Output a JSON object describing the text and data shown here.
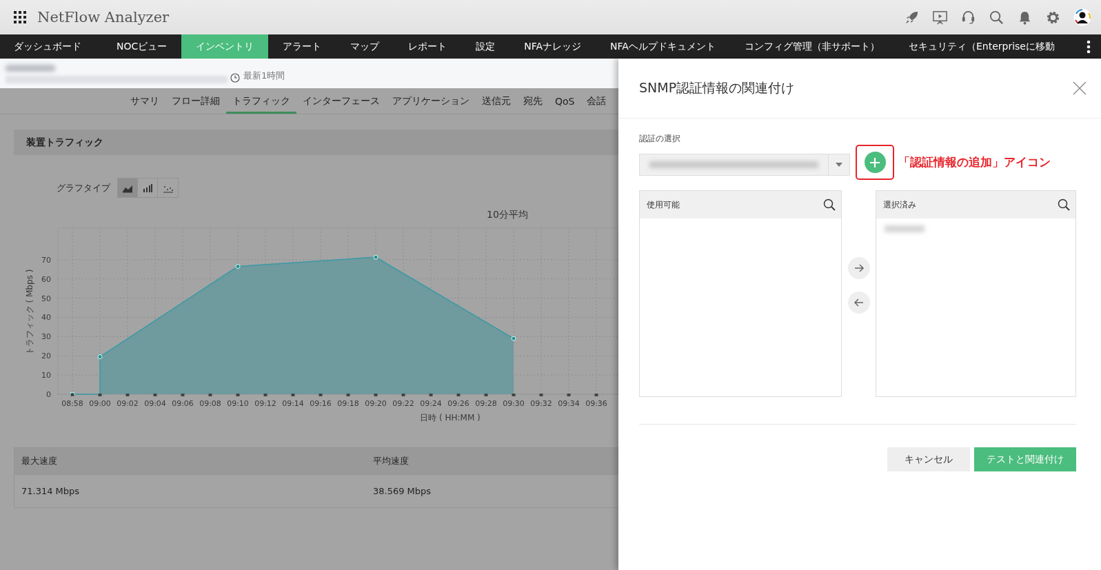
{
  "app": {
    "title": "NetFlow Analyzer"
  },
  "nav": [
    {
      "label": "ダッシュボード",
      "selected": false
    },
    {
      "label": "NOCビュー",
      "selected": false
    },
    {
      "label": "インベントリ",
      "selected": true
    },
    {
      "label": "アラート",
      "selected": false
    },
    {
      "label": "マップ",
      "selected": false
    },
    {
      "label": "レポート",
      "selected": false
    },
    {
      "label": "設定",
      "selected": false
    },
    {
      "label": "NFAナレッジ",
      "selected": false
    },
    {
      "label": "NFAヘルプドキュメント",
      "selected": false
    },
    {
      "label": "コンフィグ管理（非サポート）",
      "selected": false
    },
    {
      "label": "セキュリティ（Enterpriseに移動",
      "selected": false
    }
  ],
  "subheader": {
    "time_range": "最新1時間"
  },
  "tabs": [
    {
      "label": "サマリ",
      "selected": false
    },
    {
      "label": "フロー詳細",
      "selected": false
    },
    {
      "label": "トラフィック",
      "selected": true
    },
    {
      "label": "インターフェース",
      "selected": false
    },
    {
      "label": "アプリケーション",
      "selected": false
    },
    {
      "label": "送信元",
      "selected": false
    },
    {
      "label": "宛先",
      "selected": false
    },
    {
      "label": "QoS",
      "selected": false
    },
    {
      "label": "会話",
      "selected": false
    }
  ],
  "section": {
    "title": "装置トラフィック",
    "graph_type_label": "グラフタイプ",
    "graph_types": [
      {
        "kind": "area",
        "selected": true
      },
      {
        "kind": "bar",
        "selected": false
      },
      {
        "kind": "scatter",
        "selected": false
      }
    ],
    "chart_data": {
      "type": "area",
      "title": "10分平均",
      "xlabel": "日時 ( HH:MM )",
      "ylabel": "トラフィック ( Mbps )",
      "categories": [
        "08:58",
        "09:00",
        "09:02",
        "09:04",
        "09:06",
        "09:08",
        "09:10",
        "09:12",
        "09:14",
        "09:16",
        "09:18",
        "09:20",
        "09:22",
        "09:24",
        "09:26",
        "09:28",
        "09:30",
        "09:32",
        "09:34",
        "09:36"
      ],
      "grid": true,
      "series": [
        {
          "color": "#6f9a9e",
          "values": [
            0,
            19.5,
            null,
            null,
            null,
            null,
            66.5,
            null,
            null,
            null,
            null,
            71.3,
            null,
            null,
            null,
            null,
            29,
            null,
            null,
            null
          ]
        }
      ],
      "ylim": [
        0,
        86.4
      ],
      "yticks": [
        0,
        10,
        20,
        30,
        40,
        50,
        60,
        70
      ]
    }
  },
  "stats_table": {
    "columns": [
      "最大速度",
      "平均速度"
    ],
    "rows": [
      [
        "71.314 Mbps",
        "38.569 Mbps"
      ]
    ]
  },
  "dialog": {
    "title": "SNMP認証情報の関連付け",
    "select_label": "認証の選択",
    "annotation": "「認証情報の追加」アイコン",
    "available": {
      "title": "使用可能"
    },
    "chosen": {
      "title": "選択済み"
    },
    "buttons": [
      {
        "label": "キャンセル",
        "kind": "secondary"
      },
      {
        "label": "テストと関連付け",
        "kind": "primary"
      }
    ]
  }
}
